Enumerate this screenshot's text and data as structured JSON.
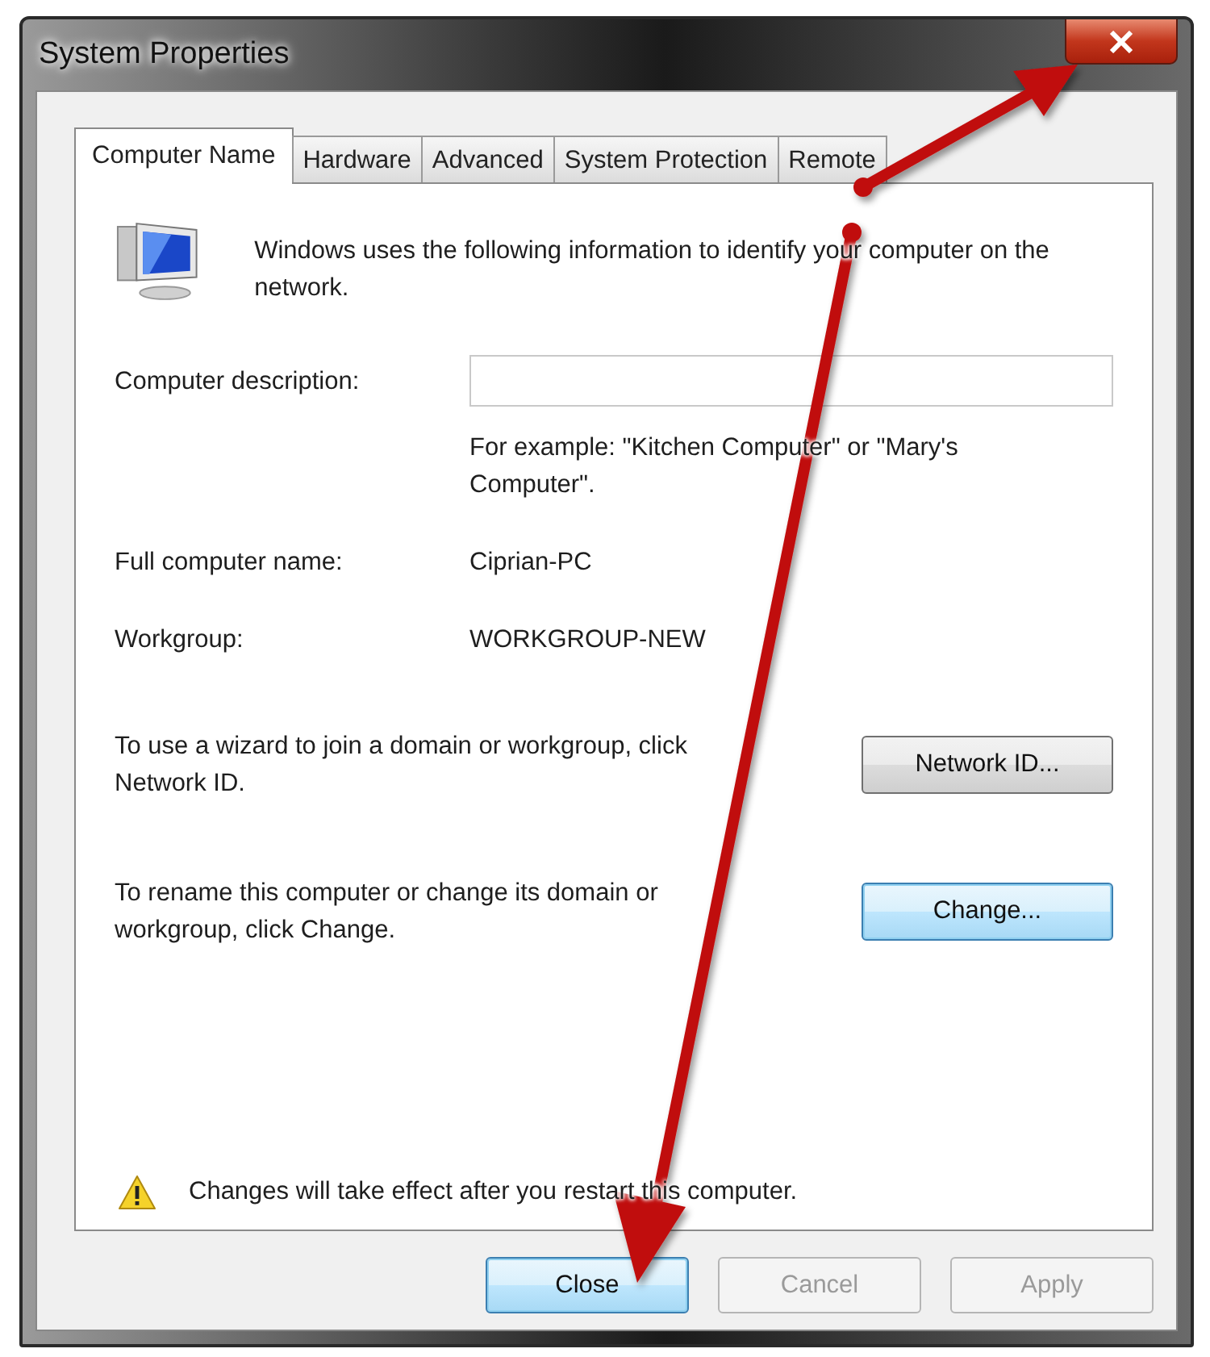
{
  "window": {
    "title": "System Properties"
  },
  "tabs": [
    {
      "label": "Computer Name",
      "selected": true
    },
    {
      "label": "Hardware",
      "selected": false
    },
    {
      "label": "Advanced",
      "selected": false
    },
    {
      "label": "System Protection",
      "selected": false
    },
    {
      "label": "Remote",
      "selected": false
    }
  ],
  "intro": "Windows uses the following information to identify your computer on the network.",
  "description": {
    "label": "Computer description:",
    "hint": "For example: \"Kitchen Computer\" or \"Mary's Computer\"."
  },
  "info": [
    {
      "label": "Full computer name:",
      "value": "Ciprian-PC"
    },
    {
      "label": "Workgroup:",
      "value": "WORKGROUP-NEW"
    }
  ],
  "actions": [
    {
      "text": "To use a wizard to join a domain or workgroup, click Network ID.",
      "button": "Network ID...",
      "focused": false
    },
    {
      "text": "To rename this computer or change its domain or workgroup, click Change.",
      "button": "Change...",
      "focused": true
    }
  ],
  "warning": "Changes will take effect after you restart this computer.",
  "buttons": [
    {
      "label": "Close",
      "disabled": false,
      "highlighted": true
    },
    {
      "label": "Cancel",
      "disabled": true,
      "highlighted": false
    },
    {
      "label": "Apply",
      "disabled": true,
      "highlighted": false
    }
  ]
}
